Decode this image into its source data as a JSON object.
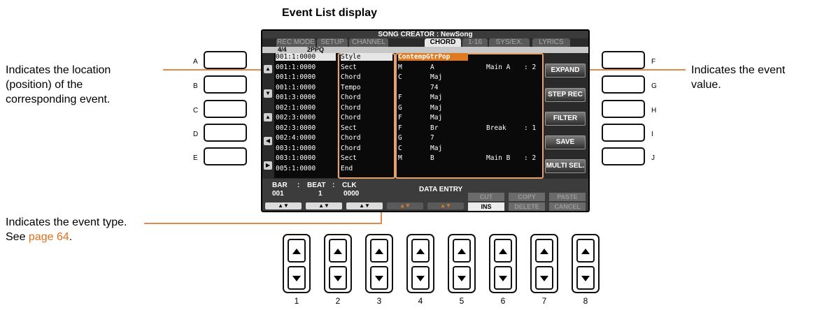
{
  "caption": "Event List display",
  "notes": {
    "location": [
      "Indicates the location",
      "(position) of the",
      "corresponding event."
    ],
    "value": [
      "Indicates the event",
      "value."
    ],
    "type_line1": "Indicates the event type.",
    "type_see": "See ",
    "type_link": "page 64",
    "type_end": "."
  },
  "side_left": [
    "A",
    "B",
    "C",
    "D",
    "E"
  ],
  "side_right": [
    "F",
    "G",
    "H",
    "I",
    "J"
  ],
  "screen": {
    "title": "SONG CREATOR : NewSong",
    "tabs": [
      "REC MODE",
      "SETUP",
      "CHANNEL",
      "CHORD",
      "1-16",
      "SYS/EX.",
      "LYRICS"
    ],
    "active_tab": "CHORD",
    "time_sig": "4/4",
    "ppq": "2PPQ",
    "rows": [
      {
        "pos": "001:1:0000",
        "type": "Style",
        "v1": "ContempGtrPop",
        "v2": "",
        "v3": "",
        "v4": ""
      },
      {
        "pos": "001:1:0000",
        "type": "Sect",
        "v1": "M",
        "v2": "A",
        "v3": "Main A",
        "v4": ": 2"
      },
      {
        "pos": "001:1:0000",
        "type": "Chord",
        "v1": "C",
        "v2": "Maj",
        "v3": "",
        "v4": ""
      },
      {
        "pos": "001:1:0000",
        "type": "Tempo",
        "v1": "",
        "v2": "74",
        "v3": "",
        "v4": ""
      },
      {
        "pos": "001:3:0000",
        "type": "Chord",
        "v1": "F",
        "v2": "Maj",
        "v3": "",
        "v4": ""
      },
      {
        "pos": "002:1:0000",
        "type": "Chord",
        "v1": "G",
        "v2": "Maj",
        "v3": "",
        "v4": ""
      },
      {
        "pos": "002:3:0000",
        "type": "Chord",
        "v1": "F",
        "v2": "Maj",
        "v3": "",
        "v4": ""
      },
      {
        "pos": "002:3:0000",
        "type": "Sect",
        "v1": "F",
        "v2": "Br",
        "v3": "Break",
        "v4": ": 1"
      },
      {
        "pos": "002:4:0000",
        "type": "Chord",
        "v1": "G",
        "v2": "7",
        "v3": "",
        "v4": ""
      },
      {
        "pos": "003:1:0000",
        "type": "Chord",
        "v1": "C",
        "v2": "Maj",
        "v3": "",
        "v4": ""
      },
      {
        "pos": "003:1:0000",
        "type": "Sect",
        "v1": "M",
        "v2": "B",
        "v3": "Main B",
        "v4": ": 2"
      },
      {
        "pos": "005:1:0000",
        "type": "End",
        "v1": "",
        "v2": "",
        "v3": "",
        "v4": ""
      }
    ],
    "side_buttons": [
      "EXPAND",
      "STEP REC",
      "FILTER",
      "SAVE",
      "MULTI SEL."
    ],
    "bar_label": "BAR",
    "beat_label": "BEAT",
    "clk_label": "CLK",
    "bar_value": "001",
    "beat_value": "1",
    "clk_value": "0000",
    "data_entry": "DATA ENTRY",
    "cut": "CUT",
    "copy": "COPY",
    "paste": "PASTE",
    "ins": "INS",
    "delete": "DELETE",
    "cancel": "CANCEL",
    "arrow_label": "▲▼"
  },
  "numbers": [
    "1",
    "2",
    "3",
    "4",
    "5",
    "6",
    "7",
    "8"
  ],
  "colors": {
    "accent": "#e8a06a",
    "link": "#e0701c"
  }
}
